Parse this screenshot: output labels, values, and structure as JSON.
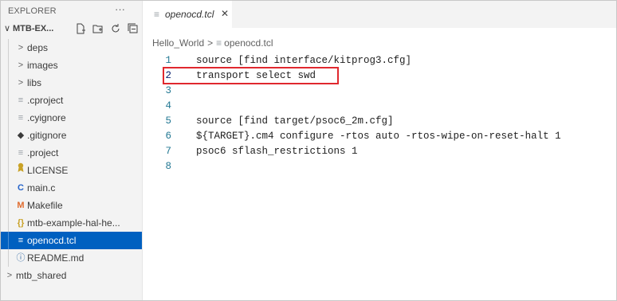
{
  "sidebar": {
    "title": "EXPLORER",
    "more_label": "···",
    "folder_label": "MTB-EX...",
    "items": [
      {
        "label": "deps",
        "icon": "chevron-right-icon",
        "glyph": ">"
      },
      {
        "label": "images",
        "icon": "chevron-right-icon",
        "glyph": ">"
      },
      {
        "label": "libs",
        "icon": "chevron-right-icon",
        "glyph": ">"
      },
      {
        "label": ".cproject",
        "icon": "lines-file-icon",
        "glyph": "≡"
      },
      {
        "label": ".cyignore",
        "icon": "lines-file-icon",
        "glyph": "≡"
      },
      {
        "label": ".gitignore",
        "icon": "git-icon",
        "glyph": "◆"
      },
      {
        "label": ".project",
        "icon": "lines-file-icon",
        "glyph": "≡"
      },
      {
        "label": "LICENSE",
        "icon": "license-icon",
        "glyph": "🎗"
      },
      {
        "label": "main.c",
        "icon": "c-file-icon",
        "glyph": "C"
      },
      {
        "label": "Makefile",
        "icon": "makefile-icon",
        "glyph": "M"
      },
      {
        "label": "mtb-example-hal-he...",
        "icon": "json-icon",
        "glyph": "{}"
      },
      {
        "label": "openocd.tcl",
        "icon": "lines-file-icon",
        "glyph": "≡"
      },
      {
        "label": "README.md",
        "icon": "info-icon",
        "glyph": "ⓘ"
      },
      {
        "label": "mtb_shared",
        "icon": "chevron-right-icon",
        "glyph": ">"
      }
    ]
  },
  "tab": {
    "label": "openocd.tcl",
    "icon_glyph": "≡",
    "close_glyph": "✕"
  },
  "breadcrumb": {
    "folder": "Hello_World",
    "sep": ">",
    "file_icon": "≡",
    "file": "openocd.tcl"
  },
  "code": {
    "lines": [
      {
        "num": "1",
        "text": "source [find interface/kitprog3.cfg]"
      },
      {
        "num": "2",
        "text": "transport select swd"
      },
      {
        "num": "3",
        "text": ""
      },
      {
        "num": "4",
        "text": ""
      },
      {
        "num": "5",
        "text": "source [find target/psoc6_2m.cfg]"
      },
      {
        "num": "6",
        "text": "${TARGET}.cm4 configure -rtos auto -rtos-wipe-on-reset-halt 1"
      },
      {
        "num": "7",
        "text": "psoc6 sflash_restrictions 1"
      },
      {
        "num": "8",
        "text": ""
      }
    ]
  },
  "colors": {
    "selection": "#0060c0",
    "highlight_box": "#e0282e",
    "line_number": "#237893"
  }
}
